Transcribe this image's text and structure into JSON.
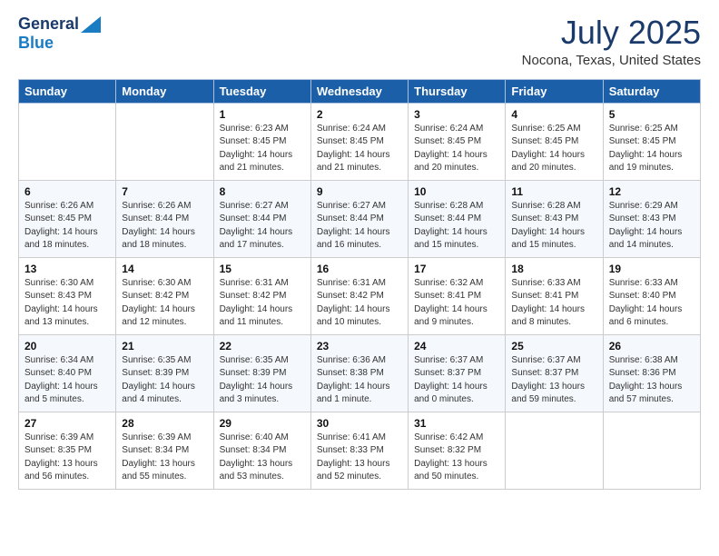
{
  "header": {
    "logo_general": "General",
    "logo_blue": "Blue",
    "month": "July 2025",
    "location": "Nocona, Texas, United States"
  },
  "weekdays": [
    "Sunday",
    "Monday",
    "Tuesday",
    "Wednesday",
    "Thursday",
    "Friday",
    "Saturday"
  ],
  "weeks": [
    [
      {
        "day": "",
        "detail": ""
      },
      {
        "day": "",
        "detail": ""
      },
      {
        "day": "1",
        "detail": "Sunrise: 6:23 AM\nSunset: 8:45 PM\nDaylight: 14 hours\nand 21 minutes."
      },
      {
        "day": "2",
        "detail": "Sunrise: 6:24 AM\nSunset: 8:45 PM\nDaylight: 14 hours\nand 21 minutes."
      },
      {
        "day": "3",
        "detail": "Sunrise: 6:24 AM\nSunset: 8:45 PM\nDaylight: 14 hours\nand 20 minutes."
      },
      {
        "day": "4",
        "detail": "Sunrise: 6:25 AM\nSunset: 8:45 PM\nDaylight: 14 hours\nand 20 minutes."
      },
      {
        "day": "5",
        "detail": "Sunrise: 6:25 AM\nSunset: 8:45 PM\nDaylight: 14 hours\nand 19 minutes."
      }
    ],
    [
      {
        "day": "6",
        "detail": "Sunrise: 6:26 AM\nSunset: 8:45 PM\nDaylight: 14 hours\nand 18 minutes."
      },
      {
        "day": "7",
        "detail": "Sunrise: 6:26 AM\nSunset: 8:44 PM\nDaylight: 14 hours\nand 18 minutes."
      },
      {
        "day": "8",
        "detail": "Sunrise: 6:27 AM\nSunset: 8:44 PM\nDaylight: 14 hours\nand 17 minutes."
      },
      {
        "day": "9",
        "detail": "Sunrise: 6:27 AM\nSunset: 8:44 PM\nDaylight: 14 hours\nand 16 minutes."
      },
      {
        "day": "10",
        "detail": "Sunrise: 6:28 AM\nSunset: 8:44 PM\nDaylight: 14 hours\nand 15 minutes."
      },
      {
        "day": "11",
        "detail": "Sunrise: 6:28 AM\nSunset: 8:43 PM\nDaylight: 14 hours\nand 15 minutes."
      },
      {
        "day": "12",
        "detail": "Sunrise: 6:29 AM\nSunset: 8:43 PM\nDaylight: 14 hours\nand 14 minutes."
      }
    ],
    [
      {
        "day": "13",
        "detail": "Sunrise: 6:30 AM\nSunset: 8:43 PM\nDaylight: 14 hours\nand 13 minutes."
      },
      {
        "day": "14",
        "detail": "Sunrise: 6:30 AM\nSunset: 8:42 PM\nDaylight: 14 hours\nand 12 minutes."
      },
      {
        "day": "15",
        "detail": "Sunrise: 6:31 AM\nSunset: 8:42 PM\nDaylight: 14 hours\nand 11 minutes."
      },
      {
        "day": "16",
        "detail": "Sunrise: 6:31 AM\nSunset: 8:42 PM\nDaylight: 14 hours\nand 10 minutes."
      },
      {
        "day": "17",
        "detail": "Sunrise: 6:32 AM\nSunset: 8:41 PM\nDaylight: 14 hours\nand 9 minutes."
      },
      {
        "day": "18",
        "detail": "Sunrise: 6:33 AM\nSunset: 8:41 PM\nDaylight: 14 hours\nand 8 minutes."
      },
      {
        "day": "19",
        "detail": "Sunrise: 6:33 AM\nSunset: 8:40 PM\nDaylight: 14 hours\nand 6 minutes."
      }
    ],
    [
      {
        "day": "20",
        "detail": "Sunrise: 6:34 AM\nSunset: 8:40 PM\nDaylight: 14 hours\nand 5 minutes."
      },
      {
        "day": "21",
        "detail": "Sunrise: 6:35 AM\nSunset: 8:39 PM\nDaylight: 14 hours\nand 4 minutes."
      },
      {
        "day": "22",
        "detail": "Sunrise: 6:35 AM\nSunset: 8:39 PM\nDaylight: 14 hours\nand 3 minutes."
      },
      {
        "day": "23",
        "detail": "Sunrise: 6:36 AM\nSunset: 8:38 PM\nDaylight: 14 hours\nand 1 minute."
      },
      {
        "day": "24",
        "detail": "Sunrise: 6:37 AM\nSunset: 8:37 PM\nDaylight: 14 hours\nand 0 minutes."
      },
      {
        "day": "25",
        "detail": "Sunrise: 6:37 AM\nSunset: 8:37 PM\nDaylight: 13 hours\nand 59 minutes."
      },
      {
        "day": "26",
        "detail": "Sunrise: 6:38 AM\nSunset: 8:36 PM\nDaylight: 13 hours\nand 57 minutes."
      }
    ],
    [
      {
        "day": "27",
        "detail": "Sunrise: 6:39 AM\nSunset: 8:35 PM\nDaylight: 13 hours\nand 56 minutes."
      },
      {
        "day": "28",
        "detail": "Sunrise: 6:39 AM\nSunset: 8:34 PM\nDaylight: 13 hours\nand 55 minutes."
      },
      {
        "day": "29",
        "detail": "Sunrise: 6:40 AM\nSunset: 8:34 PM\nDaylight: 13 hours\nand 53 minutes."
      },
      {
        "day": "30",
        "detail": "Sunrise: 6:41 AM\nSunset: 8:33 PM\nDaylight: 13 hours\nand 52 minutes."
      },
      {
        "day": "31",
        "detail": "Sunrise: 6:42 AM\nSunset: 8:32 PM\nDaylight: 13 hours\nand 50 minutes."
      },
      {
        "day": "",
        "detail": ""
      },
      {
        "day": "",
        "detail": ""
      }
    ]
  ]
}
